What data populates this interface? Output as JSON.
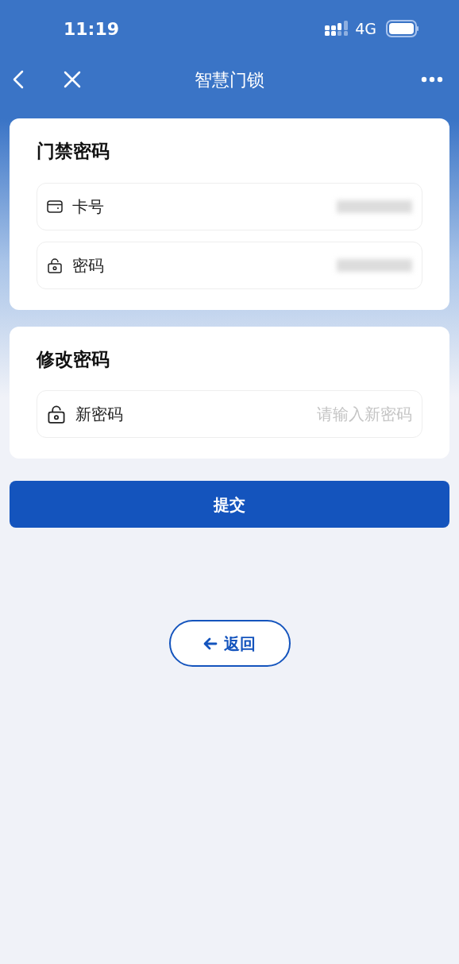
{
  "status_bar": {
    "time": "11:19",
    "network": "4G"
  },
  "nav_bar": {
    "title": "智慧门锁"
  },
  "sections": [
    {
      "title": "门禁密码",
      "rows": [
        {
          "kind": "card",
          "label": "卡号",
          "redacted": true
        },
        {
          "kind": "lock",
          "label": "密码",
          "redacted": true
        }
      ]
    },
    {
      "title": "修改密码",
      "rows": [
        {
          "kind": "input",
          "label": "新密码",
          "placeholder": "请输入新密码"
        }
      ]
    }
  ],
  "submit_button": "提交",
  "back_button": "返回"
}
